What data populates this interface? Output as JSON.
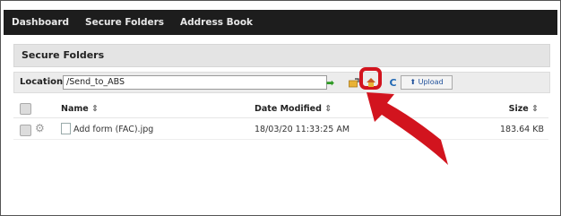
{
  "nav": [
    "Dashboard",
    "Secure Folders",
    "Address Book"
  ],
  "header": {
    "title": "Secure Folders"
  },
  "location": {
    "label": "Location",
    "value": "/Send_to_ABS"
  },
  "toolbar": {
    "upload_label": "Upload",
    "go_glyph": "➡",
    "refresh_glyph": "C",
    "upload_glyph": "⬆"
  },
  "table": {
    "columns": {
      "name": "Name",
      "date": "Date Modified",
      "size": "Size"
    },
    "sort_glyph": "⇕",
    "rows": [
      {
        "name": "Add form (FAC).jpg",
        "date": "18/03/20 11:33:25 AM",
        "size": "183.64 KB"
      }
    ]
  },
  "colors": {
    "accent": "#d2141e",
    "nav_bg": "#1d1d1d",
    "header_bg": "#e4e4e4"
  },
  "icons": [
    "go-arrow-icon",
    "up-folder-icon",
    "home-upload-icon",
    "refresh-icon",
    "upload-icon",
    "gear-icon",
    "file-icon",
    "pointer-arrow-icon"
  ]
}
